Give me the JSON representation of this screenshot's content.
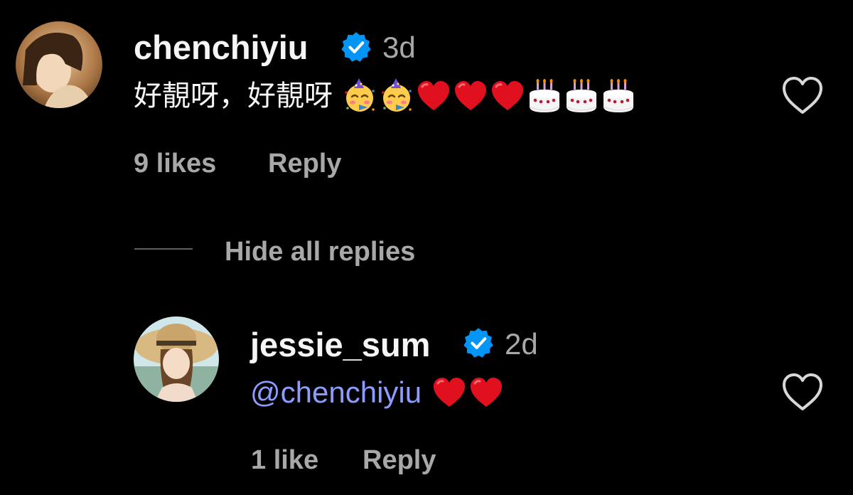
{
  "comment": {
    "username": "chenchiyiu",
    "time": "3d",
    "text_prefix": "好靚呀，好靚呀",
    "emojis": [
      "partying-face",
      "partying-face",
      "red-heart",
      "red-heart",
      "red-heart",
      "birthday-cake",
      "birthday-cake",
      "birthday-cake"
    ],
    "likes": "9 likes",
    "reply_label": "Reply"
  },
  "replies_toggle": "Hide all replies",
  "reply": {
    "username": "jessie_sum",
    "time": "2d",
    "mention": "@chenchiyiu",
    "emojis": [
      "red-heart",
      "red-heart"
    ],
    "likes": "1 like",
    "reply_label": "Reply"
  },
  "colors": {
    "background": "#000000",
    "verified": "#0095f6",
    "mention": "#8c9cff",
    "secondary_text": "#a8a8a8"
  }
}
